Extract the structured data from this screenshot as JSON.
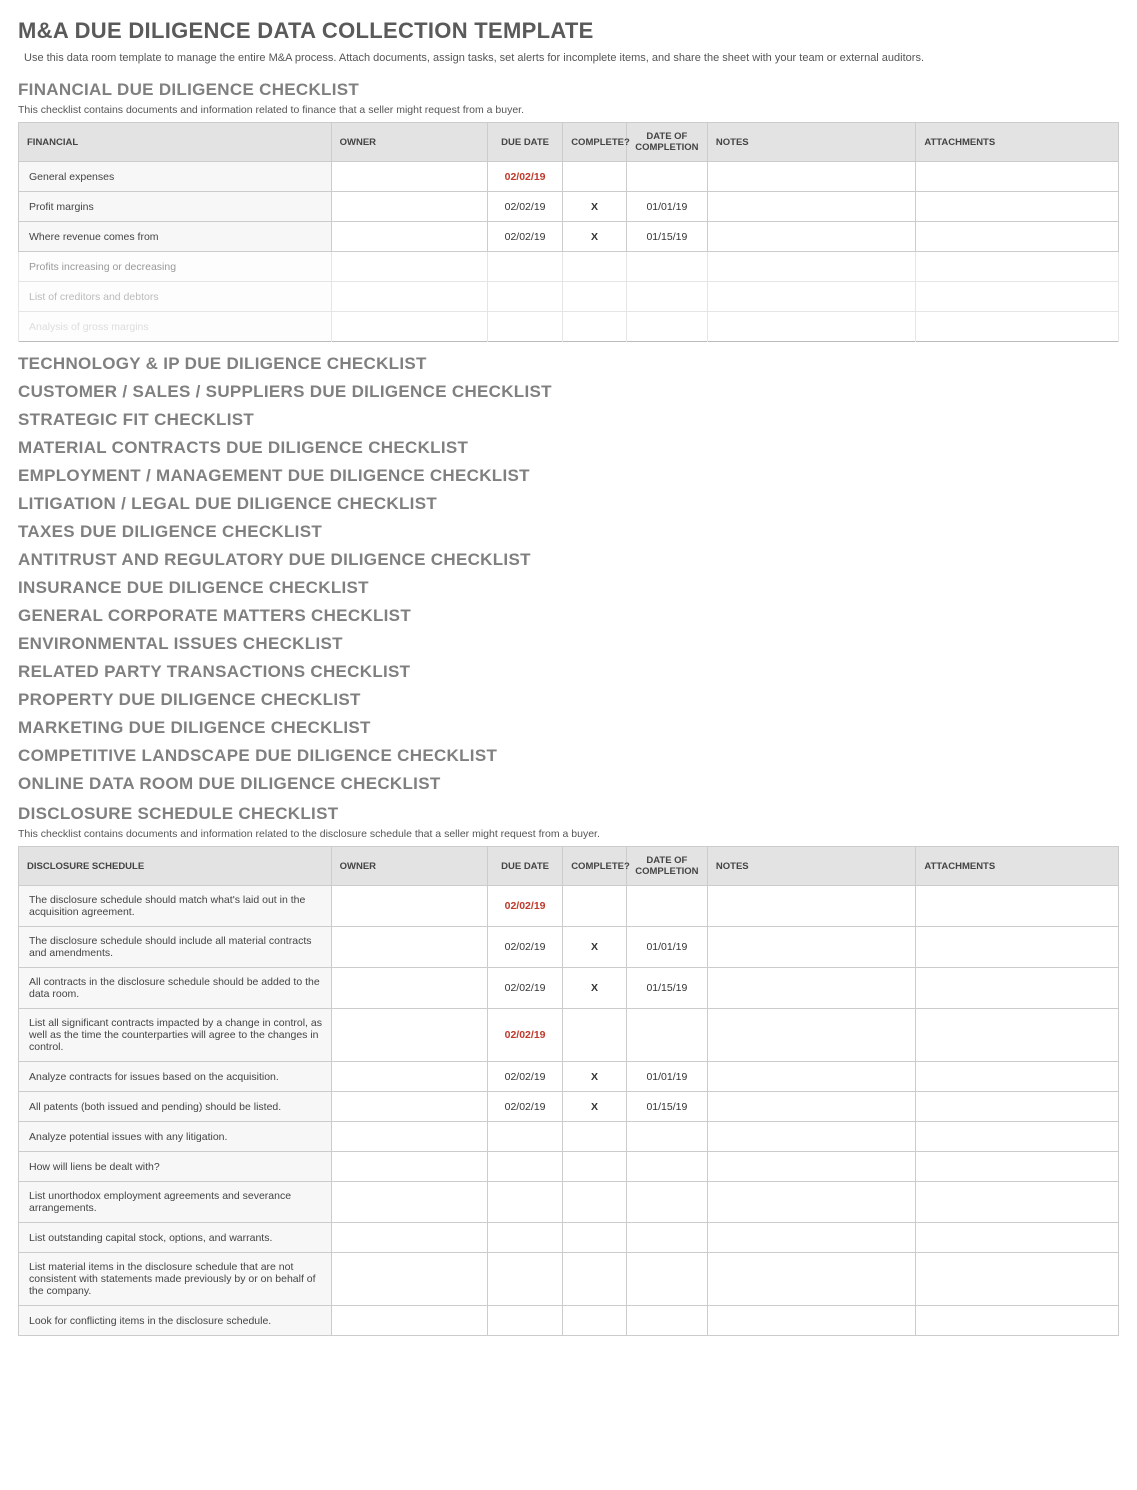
{
  "page": {
    "title": "M&A DUE DILIGENCE DATA COLLECTION TEMPLATE",
    "subtitle": "Use this data room template to manage the entire M&A process. Attach documents, assign tasks, set alerts for incomplete items, and share the sheet with your team or external auditors."
  },
  "financial": {
    "heading": "FINANCIAL DUE DILIGENCE CHECKLIST",
    "desc": "This checklist contains documents and information related to finance that a seller might request from a buyer.",
    "columns": {
      "item": "FINANCIAL",
      "owner": "OWNER",
      "due": "DUE DATE",
      "complete": "COMPLETE?",
      "docomp": "DATE OF COMPLETION",
      "notes": "NOTES",
      "attach": "ATTACHMENTS"
    },
    "rows": [
      {
        "item": "General expenses",
        "owner": "",
        "due": "02/02/19",
        "due_red": true,
        "complete": "",
        "docomp": "",
        "notes": "",
        "attach": ""
      },
      {
        "item": "Profit margins",
        "owner": "",
        "due": "02/02/19",
        "due_red": false,
        "complete": "X",
        "docomp": "01/01/19",
        "notes": "",
        "attach": ""
      },
      {
        "item": "Where revenue comes from",
        "owner": "",
        "due": "02/02/19",
        "due_red": false,
        "complete": "X",
        "docomp": "01/15/19",
        "notes": "",
        "attach": ""
      },
      {
        "item": "Profits increasing or decreasing",
        "owner": "",
        "due": "",
        "due_red": false,
        "complete": "",
        "docomp": "",
        "notes": "",
        "attach": "",
        "fade": 1
      },
      {
        "item": "List of creditors and debtors",
        "owner": "",
        "due": "",
        "due_red": false,
        "complete": "",
        "docomp": "",
        "notes": "",
        "attach": "",
        "fade": 2
      },
      {
        "item": "Analysis of gross margins",
        "owner": "",
        "due": "",
        "due_red": false,
        "complete": "",
        "docomp": "",
        "notes": "",
        "attach": "",
        "fade": 3
      }
    ]
  },
  "sections": [
    "TECHNOLOGY & IP DUE DILIGENCE CHECKLIST",
    "CUSTOMER / SALES / SUPPLIERS DUE DILIGENCE CHECKLIST",
    "STRATEGIC FIT CHECKLIST",
    "MATERIAL CONTRACTS DUE DILIGENCE CHECKLIST",
    "EMPLOYMENT / MANAGEMENT DUE DILIGENCE CHECKLIST",
    "LITIGATION / LEGAL DUE DILIGENCE CHECKLIST",
    "TAXES DUE DILIGENCE CHECKLIST",
    "ANTITRUST AND REGULATORY DUE DILIGENCE CHECKLIST",
    "INSURANCE DUE DILIGENCE CHECKLIST",
    "GENERAL CORPORATE MATTERS CHECKLIST",
    "ENVIRONMENTAL ISSUES CHECKLIST",
    "RELATED PARTY TRANSACTIONS CHECKLIST",
    "PROPERTY DUE DILIGENCE CHECKLIST",
    "MARKETING DUE DILIGENCE CHECKLIST",
    "COMPETITIVE LANDSCAPE DUE DILIGENCE CHECKLIST",
    "ONLINE DATA ROOM DUE DILIGENCE CHECKLIST"
  ],
  "disclosure": {
    "heading": "DISCLOSURE SCHEDULE CHECKLIST",
    "desc": "This checklist contains documents and information related to the disclosure schedule that a seller might request from a buyer.",
    "columns": {
      "item": "DISCLOSURE SCHEDULE",
      "owner": "OWNER",
      "due": "DUE DATE",
      "complete": "COMPLETE?",
      "docomp": "DATE OF COMPLETION",
      "notes": "NOTES",
      "attach": "ATTACHMENTS"
    },
    "rows": [
      {
        "item": "The disclosure schedule should match what's laid out in the acquisition agreement.",
        "owner": "",
        "due": "02/02/19",
        "due_red": true,
        "complete": "",
        "docomp": "",
        "notes": "",
        "attach": ""
      },
      {
        "item": "The disclosure schedule should include all material contracts and amendments.",
        "owner": "",
        "due": "02/02/19",
        "due_red": false,
        "complete": "X",
        "docomp": "01/01/19",
        "notes": "",
        "attach": ""
      },
      {
        "item": "All contracts in the disclosure schedule should be added to the data room.",
        "owner": "",
        "due": "02/02/19",
        "due_red": false,
        "complete": "X",
        "docomp": "01/15/19",
        "notes": "",
        "attach": ""
      },
      {
        "item": "List all significant contracts impacted by a change in control, as well as the time the counterparties will agree to the changes in control.",
        "owner": "",
        "due": "02/02/19",
        "due_red": true,
        "complete": "",
        "docomp": "",
        "notes": "",
        "attach": ""
      },
      {
        "item": "Analyze contracts for issues based on the acquisition.",
        "owner": "",
        "due": "02/02/19",
        "due_red": false,
        "complete": "X",
        "docomp": "01/01/19",
        "notes": "",
        "attach": ""
      },
      {
        "item": "All patents (both issued and pending) should be listed.",
        "owner": "",
        "due": "02/02/19",
        "due_red": false,
        "complete": "X",
        "docomp": "01/15/19",
        "notes": "",
        "attach": ""
      },
      {
        "item": "Analyze potential issues with any litigation.",
        "owner": "",
        "due": "",
        "due_red": false,
        "complete": "",
        "docomp": "",
        "notes": "",
        "attach": ""
      },
      {
        "item": "How will liens be dealt with?",
        "owner": "",
        "due": "",
        "due_red": false,
        "complete": "",
        "docomp": "",
        "notes": "",
        "attach": ""
      },
      {
        "item": "List unorthodox employment agreements and severance arrangements.",
        "owner": "",
        "due": "",
        "due_red": false,
        "complete": "",
        "docomp": "",
        "notes": "",
        "attach": ""
      },
      {
        "item": "List outstanding capital stock, options, and warrants.",
        "owner": "",
        "due": "",
        "due_red": false,
        "complete": "",
        "docomp": "",
        "notes": "",
        "attach": ""
      },
      {
        "item": "List material items in the disclosure schedule that are not consistent with statements made previously by or on behalf of the company.",
        "owner": "",
        "due": "",
        "due_red": false,
        "complete": "",
        "docomp": "",
        "notes": "",
        "attach": ""
      },
      {
        "item": "Look for conflicting items in the disclosure schedule.",
        "owner": "",
        "due": "",
        "due_red": false,
        "complete": "",
        "docomp": "",
        "notes": "",
        "attach": ""
      }
    ]
  }
}
